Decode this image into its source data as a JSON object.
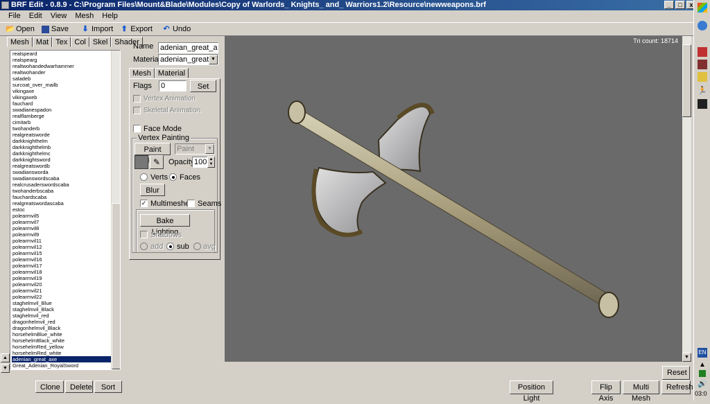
{
  "window": {
    "title": "BRF Edit - 0.8.9  - C:\\Program Files\\Mount&Blade\\Modules\\Copy of Warlords_ Knights_ and_ Warriors1.2\\Resource\\newweapons.brf",
    "minimize": "_",
    "maximize": "□",
    "close": "x"
  },
  "menu": [
    "File",
    "Edit",
    "View",
    "Mesh",
    "Help"
  ],
  "toolbar": {
    "open": "Open",
    "save": "Save",
    "import": "Import",
    "export": "Export",
    "undo": "Undo"
  },
  "left_tabs": [
    "Mesh",
    "Mat",
    "Tex",
    "Col",
    "Skel",
    "Shader"
  ],
  "mesh_list": [
    "realspeard",
    "realspearg",
    "realtwohandedwarhammer",
    "realtwohander",
    "saladeb",
    "surcoat_over_mailb",
    "vikingaxe",
    "vikingaxeb",
    "fauchard",
    "swadianespadon",
    "realflamberge",
    "cimitarb",
    "twohanderb",
    "realgreatsworde",
    "darkknighthelm",
    "darkknighthelmb",
    "darkknighthelmc",
    "darkknightsword",
    "realgreatswordb",
    "swadiansworda",
    "swadianswordscaba",
    "realcrusaderswordscaba",
    "twohanderbscaba",
    "fauchardscaba",
    "realgreatswordascaba",
    "estoc",
    "polearmvil5",
    "polearmvil7",
    "polearmvil8",
    "polearmvil9",
    "polearmvil11",
    "polearmvil12",
    "polearmvil15",
    "polearmvil16",
    "polearmvil17",
    "polearmvil18",
    "polearmvil19",
    "polearmvil20",
    "polearmvil21",
    "polearmvil22",
    "staghelmvil_Blue",
    "staghelmvil_Black",
    "staghelmvil_red",
    "dragonhelmvil_red",
    "dragonhelmvil_Black",
    "horsehelmBlue_white",
    "horsehelmBlack_white",
    "horsehelmRed_yellow",
    "horsehelmRed_white",
    "adenian_great_axe",
    "Great_Adenian_RoyalSword"
  ],
  "selected_index": 49,
  "list_buttons": {
    "clone": "Clone",
    "delete": "Delete",
    "sort": "Sort"
  },
  "props": {
    "name_label": "Name",
    "name_value": "adenian_great_axe",
    "material_label": "Material",
    "material_value": "adenian_great_axe",
    "tabs": [
      "Mesh",
      "Material"
    ],
    "flags_label": "Flags",
    "flags_value": "0",
    "set": "Set",
    "vertex_animation": "Vertex Animation",
    "skeletal_animation": "Skeletal Animation",
    "face_mode": "Face Mode",
    "vertex_painting": "Vertex Painting",
    "paint_mode": "Paint Mode",
    "paint_combo": "Paint",
    "opacity_label": "Opacity:",
    "opacity_value": "100",
    "verts": "Verts",
    "faces": "Faces",
    "blur": "Blur",
    "multimeshes": "Multimeshes",
    "seams": "Seams",
    "bake_lighting": "Bake Lighting",
    "shadows": "Shadows",
    "add": "add",
    "sub": "sub",
    "avg": "avg"
  },
  "viewport": {
    "tri_count": "Tri count: 18714",
    "reset": "Reset",
    "position_light": "Position Light",
    "flip_axis": "Flip Axis",
    "multi_mesh": "Multi Mesh",
    "refresh": "Refresh"
  },
  "sidebar": {
    "lang": "EN",
    "clock": "03:0"
  }
}
